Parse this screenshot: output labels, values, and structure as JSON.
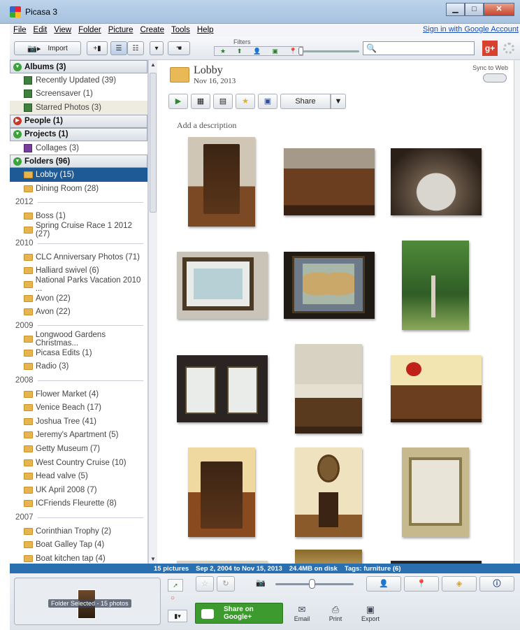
{
  "window": {
    "title": "Picasa 3"
  },
  "menu": {
    "items": [
      "File",
      "Edit",
      "View",
      "Folder",
      "Picture",
      "Create",
      "Tools",
      "Help"
    ],
    "signin": "Sign in with Google Account"
  },
  "toolbar": {
    "import_label": "Import",
    "filters_label": "Filters"
  },
  "sidebar": {
    "albums_header": "Albums (3)",
    "albums": [
      "Recently Updated (39)",
      "Screensaver (1)",
      "Starred Photos (3)"
    ],
    "people_header": "People (1)",
    "projects_header": "Projects (1)",
    "projects": [
      "Collages (3)"
    ],
    "folders_header": "Folders (96)",
    "folders_top": [
      "Lobby (15)",
      "Dining Room (28)"
    ],
    "y2012": "2012",
    "f2012": [
      "Boss (1)",
      "Spring Cruise Race 1 2012 (27)"
    ],
    "y2010": "2010",
    "f2010": [
      "CLC Anniversary Photos (71)",
      "Halliard swivel (6)",
      "National Parks Vacation 2010 ...",
      "Avon (22)",
      "Avon (22)"
    ],
    "y2009": "2009",
    "f2009": [
      "Longwood Gardens Christmas...",
      "Picasa Edits (1)",
      "Radio (3)"
    ],
    "y2008": "2008",
    "f2008": [
      "Flower Market (4)",
      "Venice Beach (17)",
      "Joshua Tree (41)",
      "Jeremy's Apartment (5)",
      "Getty Museum (7)",
      "West Country Cruise (10)",
      "Head valve (5)",
      "UK April 2008 (7)",
      "ICFriends Fleurette (8)"
    ],
    "y2007": "2007",
    "f2007": [
      "Corinthian Trophy (2)",
      "Boat Galley Tap (4)",
      "Boat kitchen tap (4)"
    ]
  },
  "main": {
    "folder_title": "Lobby",
    "folder_date": "Nov 16, 2013",
    "sync_label": "Sync to Web",
    "share_label": "Share",
    "description": "Add a description"
  },
  "status": {
    "count": "15 pictures",
    "range": "Sep 2, 2004 to Nov 15, 2013",
    "size": "24.4MB on disk",
    "tags": "Tags: furniture (6)"
  },
  "bottom": {
    "tray_label": "Folder Selected - 15 photos",
    "share_google": "Share on Google+",
    "email": "Email",
    "print": "Print",
    "export": "Export"
  },
  "colors": {
    "selection": "#1e5b96",
    "status_bar": "#2a6fb0",
    "share_green": "#3d9a2e"
  }
}
